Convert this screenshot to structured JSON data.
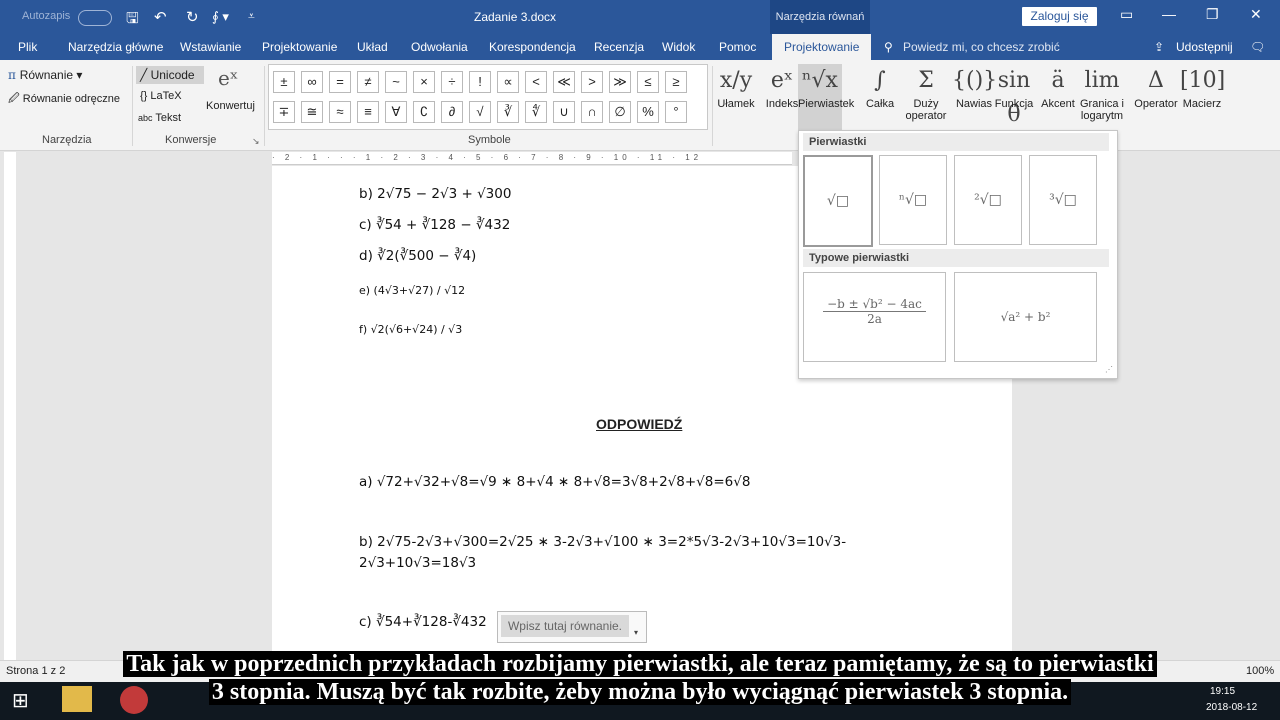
{
  "titlebar": {
    "autosave": "Autozapis",
    "doc_title": "Zadanie 3.docx",
    "context_tab": "Narzędzia równań",
    "login": "Zaloguj się"
  },
  "tabs": [
    "Plik",
    "Narzędzia główne",
    "Wstawianie",
    "Projektowanie",
    "Układ",
    "Odwołania",
    "Korespondencja",
    "Recenzja",
    "Widok",
    "Pomoc",
    "Projektowanie"
  ],
  "tellme": "Powiedz mi, co chcesz zrobić",
  "share": "Udostępnij",
  "ribbon": {
    "tools": {
      "equation": "Równanie",
      "ink": "Równanie odręczne",
      "label": "Narzędzia"
    },
    "conv": {
      "unicode": "Unicode",
      "latex": "LaTeX",
      "text": "Tekst",
      "convert": "Konwertuj",
      "label": "Konwersje"
    },
    "symbols_label": "Symbole",
    "symbols_row1": [
      "±",
      "∞",
      "=",
      "≠",
      "~",
      "×",
      "÷",
      "!",
      "∝",
      "<",
      "≪",
      ">",
      "≫",
      "≤",
      "≥"
    ],
    "symbols_row2": [
      "∓",
      "≅",
      "≈",
      "≡",
      "∀",
      "∁",
      "∂",
      "√",
      "∛",
      "∜",
      "∪",
      "∩",
      "∅",
      "%",
      "°"
    ],
    "structures": [
      {
        "icon": "x/y",
        "label": "Ułamek"
      },
      {
        "icon": "eˣ",
        "label": "Indeks"
      },
      {
        "icon": "ⁿ√x",
        "label": "Pierwiastek"
      },
      {
        "icon": "∫",
        "label": "Całka"
      },
      {
        "icon": "Σ",
        "label": "Duży operator"
      },
      {
        "icon": "{()}",
        "label": "Nawias"
      },
      {
        "icon": "sin θ",
        "label": "Funkcja"
      },
      {
        "icon": "ä",
        "label": "Akcent"
      },
      {
        "icon": "lim",
        "label": "Granica i logarytm"
      },
      {
        "icon": "Δ",
        "label": "Operator"
      },
      {
        "icon": "[10]",
        "label": "Macierz"
      }
    ]
  },
  "ruler_text": "· 2 · 1 · · · 1 · 2 · 3 · 4 · 5 · 6 · 7 · 8 · 9 · 10 · 11 · 12",
  "document": {
    "lines_top": [
      "b) 2√75 − 2√3 + √300",
      "c) ∛54 + ∛128 − ∛432",
      "d) ∛2(∛500 − ∛4)",
      "e) (4√3+√27) / √12",
      "f) √2(√6+√24) / √3"
    ],
    "answer_heading": "ODPOWIEDŹ",
    "ans_a": "a) √72+√32+√8=√9 ∗ 8+√4 ∗ 8+√8=3√8+2√8+√8=6√8",
    "ans_b1": "b) 2√75-2√3+√300=2√25 ∗ 3-2√3+√100 ∗ 3=2*5√3-2√3+10√3=10√3-",
    "ans_b2": "2√3+10√3=18√3",
    "ans_c": "c) ∛54+∛128-∛432",
    "eq_placeholder": "Wpisz tutaj równanie."
  },
  "gallery": {
    "head1": "Pierwiastki",
    "cells1": [
      "√□",
      "ⁿ√□",
      "²√□",
      "³√□"
    ],
    "head2": "Typowe pierwiastki",
    "formula1_num": "−b ± √b² − 4ac",
    "formula1_den": "2a",
    "formula2": "√a² + b²"
  },
  "status": {
    "page": "Strona 1 z 2",
    "zoom": "100%"
  },
  "subtitle": {
    "line1": "Tak jak w poprzednich przykładach rozbijamy pierwiastki, ale teraz pamiętamy, że są to pierwiastki",
    "line2": "3 stopnia. Muszą być tak rozbite, żeby można było wyciągnąć pierwiastek 3 stopnia."
  },
  "taskbar": {
    "time": "19:15",
    "date": "2018-08-12"
  }
}
